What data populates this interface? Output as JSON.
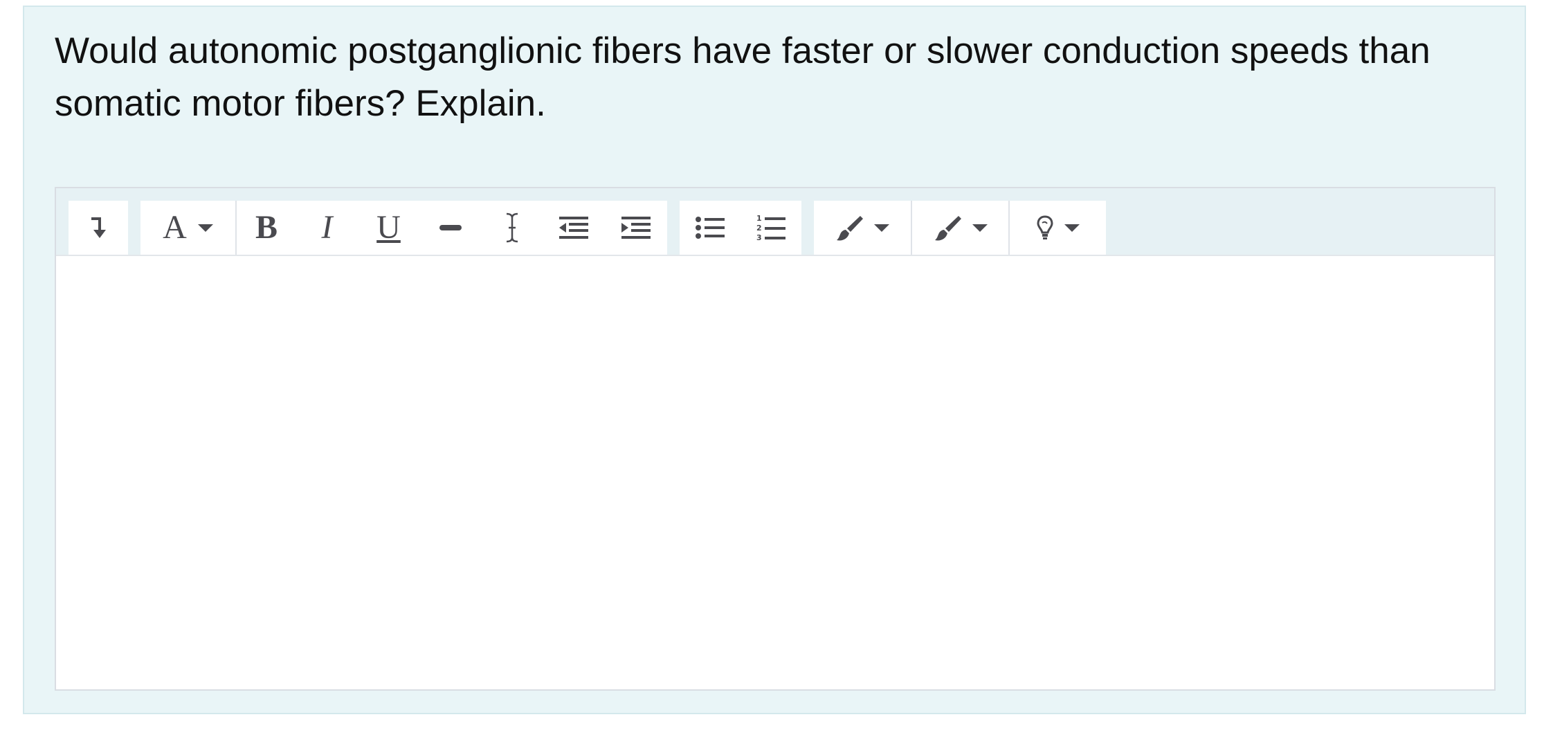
{
  "question": {
    "text": "Would autonomic postganglionic fibers have faster or slower conduction speeds than somatic motor fibers?  Explain."
  },
  "editor": {
    "toolbar": {
      "groups": [
        {
          "buttons": [
            {
              "icon": "insert-below-icon",
              "glyph": "↴"
            }
          ]
        },
        {
          "buttons": [
            {
              "icon": "font-size-icon",
              "glyph": "A",
              "dropdown": true
            },
            {
              "icon": "bold-icon",
              "glyph": "B"
            },
            {
              "icon": "italic-icon",
              "glyph": "I"
            },
            {
              "icon": "underline-icon",
              "glyph": "U"
            },
            {
              "icon": "strikethrough-icon"
            },
            {
              "icon": "clear-format-icon"
            },
            {
              "icon": "outdent-icon"
            },
            {
              "icon": "indent-icon"
            }
          ]
        },
        {
          "buttons": [
            {
              "icon": "bulleted-list-icon"
            },
            {
              "icon": "numbered-list-icon"
            }
          ]
        },
        {
          "buttons": [
            {
              "icon": "text-color-brush-icon",
              "dropdown": true
            },
            {
              "icon": "background-color-brush-icon",
              "dropdown": true
            },
            {
              "icon": "lightbulb-icon",
              "dropdown": true
            }
          ]
        }
      ]
    },
    "content": ""
  },
  "colors": {
    "card_background": "#e9f5f7",
    "icon": "#4a4a4f",
    "editor_background": "#ffffff"
  }
}
